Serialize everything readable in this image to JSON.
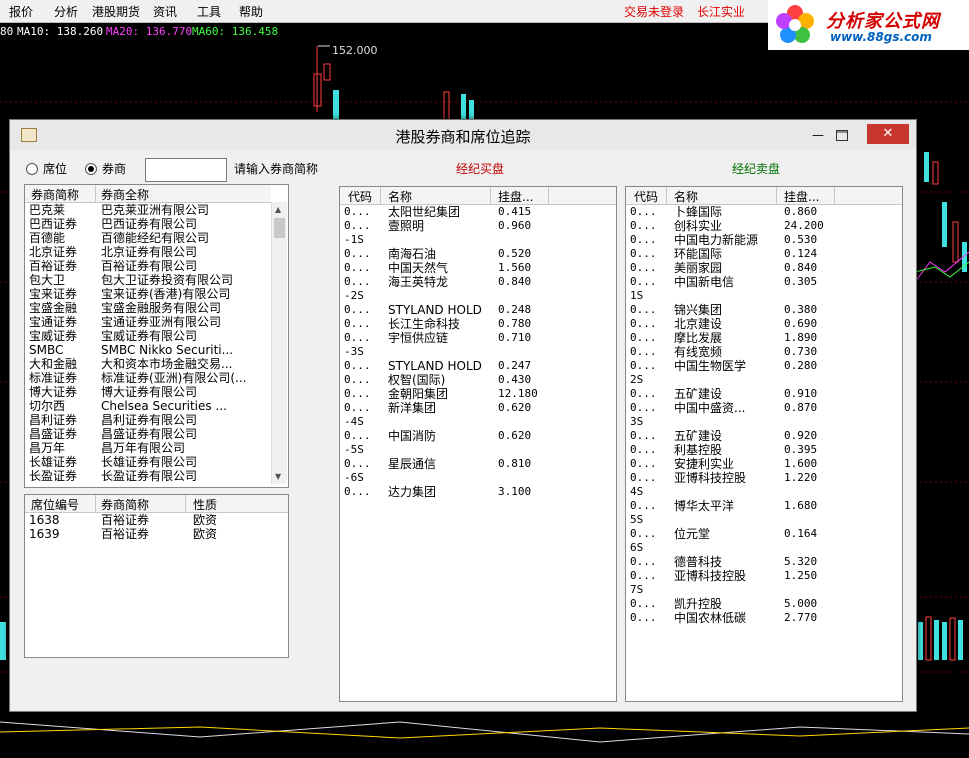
{
  "menu": [
    "报价",
    "分析",
    "港股期货",
    "资讯",
    "工具",
    "帮助"
  ],
  "status": {
    "login": "交易未登录",
    "broker": "长江实业"
  },
  "logo": {
    "title": "分析家公式网",
    "url": "www.88gs.com"
  },
  "chart": {
    "ma_prefix": "80",
    "ma10": "MA10: 138.260",
    "ma20": "MA20: 136.770",
    "ma60": "MA60: 136.458",
    "peak_label": "152.000",
    "colors": {
      "ma10": "#ffffff",
      "ma20": "#ff40ff",
      "ma60": "#40ff40"
    }
  },
  "dialog": {
    "title": "港股券商和席位追踪",
    "radio_seat": "席位",
    "radio_broker": "券商",
    "search_value": "",
    "search_hint": "请输入券商简称",
    "buy_title": "经纪买盘",
    "sell_title": "经纪卖盘",
    "broker_cols": [
      "券商简称",
      "券商全称"
    ],
    "brokers": [
      [
        "巴克莱",
        "巴克莱亚洲有限公司"
      ],
      [
        "巴西证券",
        "巴西证券有限公司"
      ],
      [
        "百德能",
        "百德能经纪有限公司"
      ],
      [
        "北京证券",
        "北京证券有限公司"
      ],
      [
        "百裕证券",
        "百裕证券有限公司"
      ],
      [
        "包大卫",
        "包大卫证券投资有限公司"
      ],
      [
        "宝来证券",
        "宝来证券(香港)有限公司"
      ],
      [
        "宝盛金融",
        "宝盛金融服务有限公司"
      ],
      [
        "宝通证券",
        "宝通证券亚洲有限公司"
      ],
      [
        "宝威证券",
        "宝威证券有限公司"
      ],
      [
        "SMBC",
        "SMBC Nikko Securiti..."
      ],
      [
        "大和金融",
        "大和资本市场金融交易..."
      ],
      [
        "标准证券",
        "标准证券(亚洲)有限公司(..."
      ],
      [
        "博大证券",
        "博大证券有限公司"
      ],
      [
        "切尔西",
        "Chelsea Securities ..."
      ],
      [
        "昌利证券",
        "昌利证券有限公司"
      ],
      [
        "昌盛证券",
        "昌盛证券有限公司"
      ],
      [
        "昌万年",
        "昌万年有限公司"
      ],
      [
        "长雄证券",
        "长雄证券有限公司"
      ],
      [
        "长盈证券",
        "长盈证券有限公司"
      ]
    ],
    "seat_cols": [
      "席位编号",
      "券商简称",
      "性质"
    ],
    "seats": [
      [
        "1638",
        "百裕证券",
        "欧资"
      ],
      [
        "1639",
        "百裕证券",
        "欧资"
      ]
    ],
    "order_cols": [
      "代码",
      "名称",
      "挂盘..."
    ],
    "buy_rows": [
      [
        "0...",
        "太阳世纪集团",
        "0.415"
      ],
      [
        "0...",
        "壹照明",
        "0.960"
      ],
      [
        "-1S",
        "",
        ""
      ],
      [
        "0...",
        "南海石油",
        "0.520"
      ],
      [
        "0...",
        "中国天然气",
        "1.560"
      ],
      [
        "0...",
        "海王英特龙",
        "0.840"
      ],
      [
        "-2S",
        "",
        ""
      ],
      [
        "0...",
        "STYLAND HOLD",
        "0.248"
      ],
      [
        "0...",
        "长江生命科技",
        "0.780"
      ],
      [
        "0...",
        "宇恒供应链",
        "0.710"
      ],
      [
        "-3S",
        "",
        ""
      ],
      [
        "0...",
        "STYLAND HOLD",
        "0.247"
      ],
      [
        "0...",
        "权智(国际)",
        "0.430"
      ],
      [
        "0...",
        "金朝阳集团",
        "12.180"
      ],
      [
        "0...",
        "新洋集团",
        "0.620"
      ],
      [
        "-4S",
        "",
        ""
      ],
      [
        "0...",
        "中国消防",
        "0.620"
      ],
      [
        "-5S",
        "",
        ""
      ],
      [
        "0...",
        "星辰通信",
        "0.810"
      ],
      [
        "-6S",
        "",
        ""
      ],
      [
        "0...",
        "达力集团",
        "3.100"
      ]
    ],
    "sell_rows": [
      [
        "0...",
        "卜蜂国际",
        "0.860"
      ],
      [
        "0...",
        "创科实业",
        "24.200"
      ],
      [
        "0...",
        "中国电力新能源",
        "0.530"
      ],
      [
        "0...",
        "环能国际",
        "0.124"
      ],
      [
        "0...",
        "美丽家园",
        "0.840"
      ],
      [
        "0...",
        "中国新电信",
        "0.305"
      ],
      [
        "1S",
        "",
        ""
      ],
      [
        "0...",
        "锦兴集团",
        "0.380"
      ],
      [
        "0...",
        "北京建设",
        "0.690"
      ],
      [
        "0...",
        "摩比发展",
        "1.890"
      ],
      [
        "0...",
        "有线宽频",
        "0.730"
      ],
      [
        "0...",
        "中国生物医学",
        "0.280"
      ],
      [
        "2S",
        "",
        ""
      ],
      [
        "0...",
        "五矿建设",
        "0.910"
      ],
      [
        "0...",
        "中国中盛资...",
        "0.870"
      ],
      [
        "3S",
        "",
        ""
      ],
      [
        "0...",
        "五矿建设",
        "0.920"
      ],
      [
        "0...",
        "利基控股",
        "0.395"
      ],
      [
        "0...",
        "安捷利实业",
        "1.600"
      ],
      [
        "0...",
        "亚博科技控股",
        "1.220"
      ],
      [
        "4S",
        "",
        ""
      ],
      [
        "0...",
        "博华太平洋",
        "1.680"
      ],
      [
        "5S",
        "",
        ""
      ],
      [
        "0...",
        "位元堂",
        "0.164"
      ],
      [
        "6S",
        "",
        ""
      ],
      [
        "0...",
        "德普科技",
        "5.320"
      ],
      [
        "0...",
        "亚博科技控股",
        "1.250"
      ],
      [
        "7S",
        "",
        ""
      ],
      [
        "0...",
        "凯升控股",
        "5.000"
      ],
      [
        "0...",
        "中国农林低碳",
        "2.770"
      ]
    ]
  }
}
